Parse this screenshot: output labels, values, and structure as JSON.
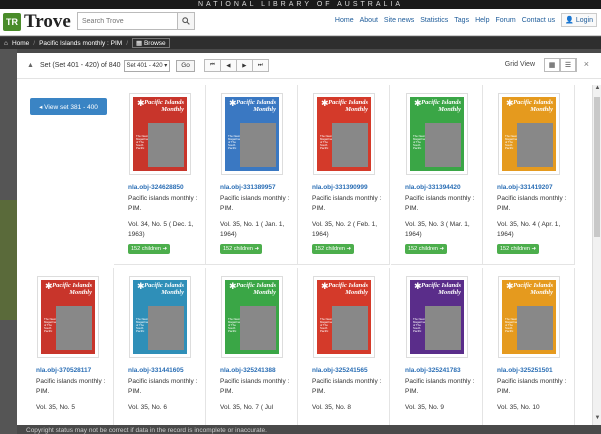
{
  "site": {
    "banner": "NATIONAL LIBRARY OF AUSTRALIA",
    "logo_mark": "TR",
    "logo_text": "Trove",
    "search_placeholder": "Search Trove",
    "nav": [
      "Home",
      "About",
      "Site news",
      "Statistics",
      "Tags",
      "Help",
      "Forum",
      "Contact us"
    ],
    "login": "Login"
  },
  "breadcrumb": {
    "home": "Home",
    "item": "Pacific Islands monthly : PIM",
    "browse": "Browse"
  },
  "toolbar": {
    "set_label": "Set (Set 401 - 420) of 840",
    "set_select": "Set 401 - 420",
    "go": "Go",
    "pager": [
      "⏮",
      "◀",
      "▶",
      "⏭"
    ],
    "view_label": "Grid View",
    "close": "×"
  },
  "prev_set_button": "◂ View set 381 - 400",
  "items": [
    {
      "id": "nla.obj-324628850",
      "title": "Pacific islands monthly : PIM.",
      "vol": "Vol. 34, No. 5 ( Dec. 1, 1963)",
      "children": "152 children",
      "color": "#c8352b"
    },
    {
      "id": "nla.obj-331389957",
      "title": "Pacific islands monthly : PIM.",
      "vol": "Vol. 35, No. 1 ( Jan. 1, 1964)",
      "children": "152 children",
      "color": "#3a78c2"
    },
    {
      "id": "nla.obj-331390999",
      "title": "Pacific islands monthly : PIM.",
      "vol": "Vol. 35, No. 2 ( Feb. 1, 1964)",
      "children": "152 children",
      "color": "#d43a2a"
    },
    {
      "id": "nla.obj-331394420",
      "title": "Pacific islands monthly : PIM.",
      "vol": "Vol. 35, No. 3 ( Mar. 1, 1964)",
      "children": "152 children",
      "color": "#3aa646"
    },
    {
      "id": "nla.obj-331419207",
      "title": "Pacific islands monthly : PIM.",
      "vol": "Vol. 35, No. 4 ( Apr. 1, 1964)",
      "children": "152 children",
      "color": "#e59a1e"
    },
    {
      "id": "nla.obj-370528117",
      "title": "Pacific islands monthly : PIM.",
      "vol": "Vol. 35, No. 5",
      "children": "",
      "color": "#c8352b"
    },
    {
      "id": "nla.obj-331441605",
      "title": "Pacific islands monthly : PIM.",
      "vol": "Vol. 35, No. 6",
      "children": "",
      "color": "#2f8fb8"
    },
    {
      "id": "nla.obj-325241388",
      "title": "Pacific islands monthly : PIM.",
      "vol": "Vol. 35, No. 7 ( Jul",
      "children": "",
      "color": "#3aa646"
    },
    {
      "id": "nla.obj-325241565",
      "title": "Pacific islands monthly : PIM.",
      "vol": "Vol. 35, No. 8",
      "children": "",
      "color": "#d43a2a"
    },
    {
      "id": "nla.obj-325241783",
      "title": "Pacific islands monthly : PIM.",
      "vol": "Vol. 35, No. 9",
      "children": "",
      "color": "#5a2d8a"
    },
    {
      "id": "nla.obj-325251501",
      "title": "Pacific islands monthly : PIM.",
      "vol": "Vol. 35, No. 10",
      "children": "",
      "color": "#e59a1e"
    }
  ],
  "cover": {
    "title": "Pacific Islands Monthly",
    "text": "The News Magazine of The South Pacific"
  },
  "footer_note": "Copyright status may not be correct if data in the record is incomplete or inaccurate."
}
